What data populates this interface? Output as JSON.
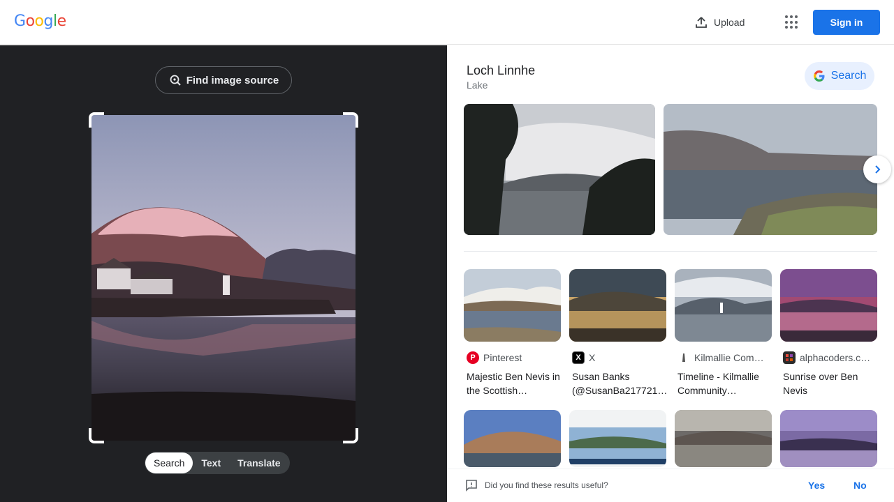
{
  "header": {
    "logo_letters": [
      {
        "ch": "G",
        "color": "#4285f4"
      },
      {
        "ch": "o",
        "color": "#ea4335"
      },
      {
        "ch": "o",
        "color": "#fbbc05"
      },
      {
        "ch": "g",
        "color": "#4285f4"
      },
      {
        "ch": "l",
        "color": "#34a853"
      },
      {
        "ch": "e",
        "color": "#ea4335"
      }
    ],
    "upload_label": "Upload",
    "apps_icon": "apps-grid-icon",
    "signin_label": "Sign in"
  },
  "lens": {
    "find_source_label": "Find image source",
    "modes": [
      "Search",
      "Text",
      "Translate"
    ],
    "active_mode": "Search"
  },
  "results": {
    "entity_title": "Loch Linnhe",
    "entity_subtitle": "Lake",
    "search_button_label": "Search",
    "cards": [
      {
        "source": "Pinterest",
        "source_icon": "pinterest-icon",
        "icon_color": "#e60023",
        "icon_glyph": "P",
        "title": "Majestic Ben Nevis in the Scottish…"
      },
      {
        "source": "X",
        "source_icon": "x-icon",
        "icon_color": "#000000",
        "icon_glyph": "X",
        "title": "Susan Banks (@SusanBa217721…"
      },
      {
        "source": "Kilmallie Com…",
        "source_icon": "lighthouse-icon",
        "icon_color": "#ffffff",
        "icon_glyph": "",
        "title": "Timeline - Kilmallie Community…"
      },
      {
        "source": "alphacoders.c…",
        "source_icon": "alphacoders-icon",
        "icon_color": "#2b2b2b",
        "icon_glyph": "",
        "title": "Sunrise over Ben Nevis"
      }
    ]
  },
  "feedback": {
    "question": "Did you find these results useful?",
    "yes": "Yes",
    "no": "No"
  },
  "colors": {
    "accent": "#1a73e8",
    "dark_panel": "#202124"
  }
}
